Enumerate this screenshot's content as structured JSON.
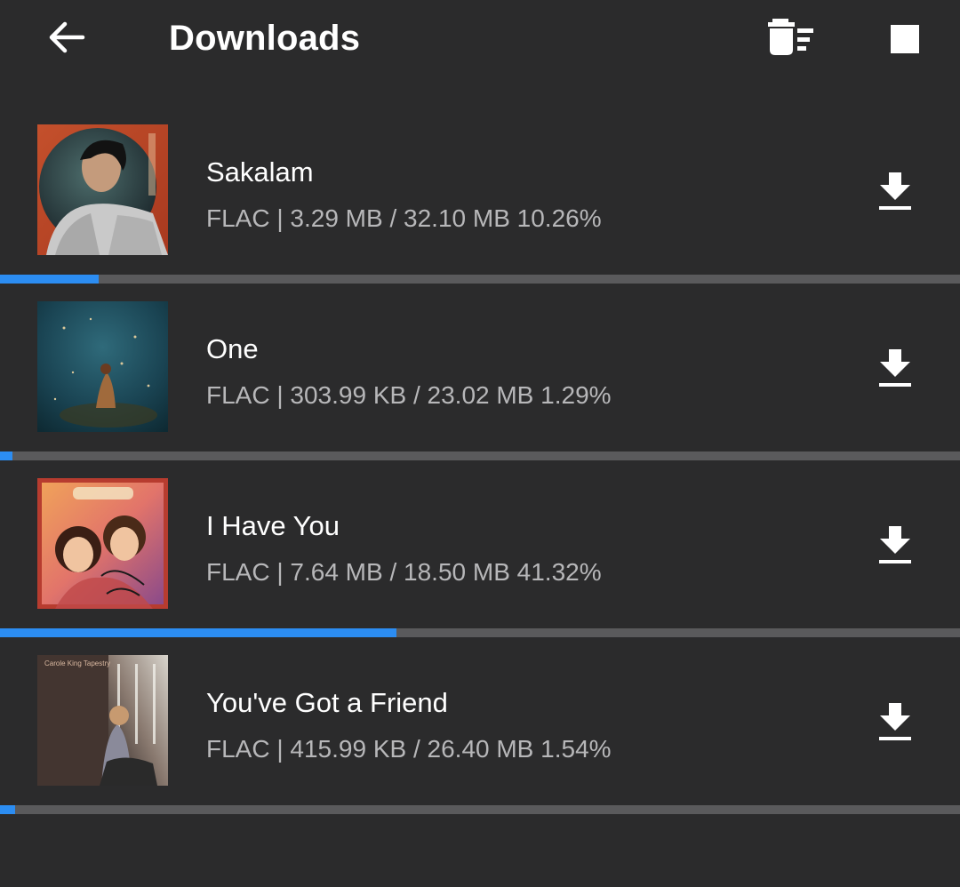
{
  "header": {
    "title": "Downloads",
    "back_icon": "arrow-left-icon",
    "clear_icon": "delete-sweep-icon",
    "stop_icon": "stop-square-icon"
  },
  "colors": {
    "background": "#2b2b2c",
    "progress_track": "#5a5a5c",
    "progress_fill": "#2c8df2",
    "meta_text": "#b7b7b9"
  },
  "downloads": [
    {
      "title": "Sakalam",
      "meta": "FLAC | 3.29 MB / 32.10 MB 10.26%",
      "progress": 0.1026,
      "action_icon": "download-icon"
    },
    {
      "title": "One",
      "meta": "FLAC | 303.99 KB / 23.02 MB 1.29%",
      "progress": 0.0129,
      "action_icon": "download-icon"
    },
    {
      "title": "I Have You",
      "meta": "FLAC | 7.64 MB / 18.50 MB 41.32%",
      "progress": 0.4132,
      "action_icon": "download-icon"
    },
    {
      "title": "You've Got a Friend",
      "meta": "FLAC | 415.99 KB / 26.40 MB 1.54%",
      "progress": 0.0154,
      "action_icon": "download-icon"
    }
  ]
}
